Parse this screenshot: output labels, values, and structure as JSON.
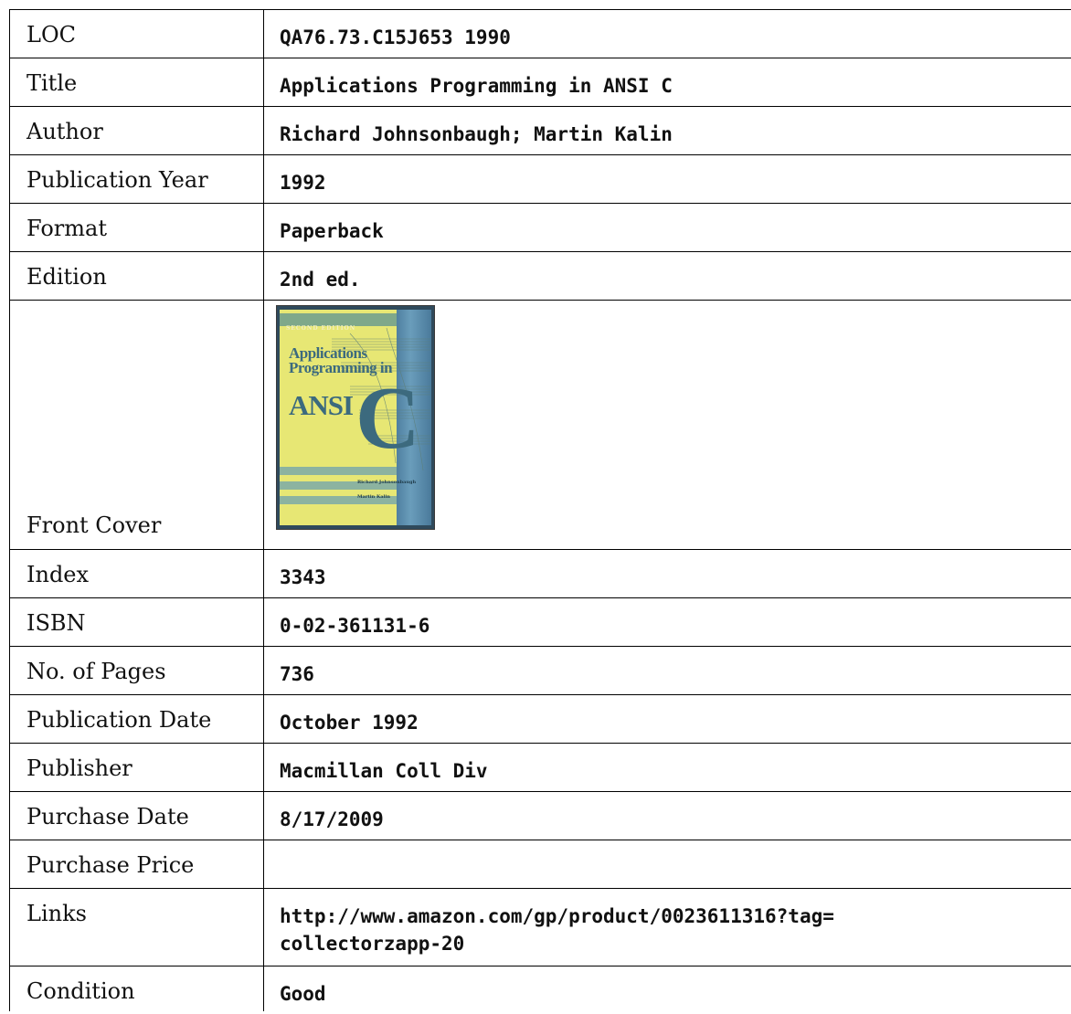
{
  "rows": [
    {
      "label": "LOC",
      "value": "QA76.73.C15J653 1990"
    },
    {
      "label": "Title",
      "value": "Applications Programming in ANSI C"
    },
    {
      "label": "Author",
      "value": "Richard Johnsonbaugh; Martin Kalin"
    },
    {
      "label": "Publication Year",
      "value": "1992"
    },
    {
      "label": "Format",
      "value": "Paperback"
    },
    {
      "label": "Edition",
      "value": "2nd ed."
    }
  ],
  "cover": {
    "label": "Front Cover",
    "edition_text": "SECOND EDITION",
    "title_line1": "Applications",
    "title_line2": "Programming in",
    "title_ansi": "ANSI",
    "title_c": "C",
    "author1": "Richard Johnsonbaugh",
    "author2": "Martin Kalin"
  },
  "rows2": [
    {
      "label": "Index",
      "value": "3343"
    },
    {
      "label": "ISBN",
      "value": "0-02-361131-6"
    },
    {
      "label": "No. of Pages",
      "value": "736"
    },
    {
      "label": "Publication Date",
      "value": "October 1992"
    },
    {
      "label": "Publisher",
      "value": "Macmillan Coll Div"
    },
    {
      "label": "Purchase Date",
      "value": "8/17/2009"
    },
    {
      "label": "Purchase Price",
      "value": ""
    }
  ],
  "links": {
    "label": "Links",
    "line1": "http://www.amazon.com/gp/product/0023611316?tag=",
    "line2": "collectorzapp-20"
  },
  "condition": {
    "label": "Condition",
    "value": "Good"
  },
  "colors": {
    "cover_yellow": "#e7e774",
    "cover_spine": "#5f8fae",
    "cover_title": "#3c6a7e"
  }
}
